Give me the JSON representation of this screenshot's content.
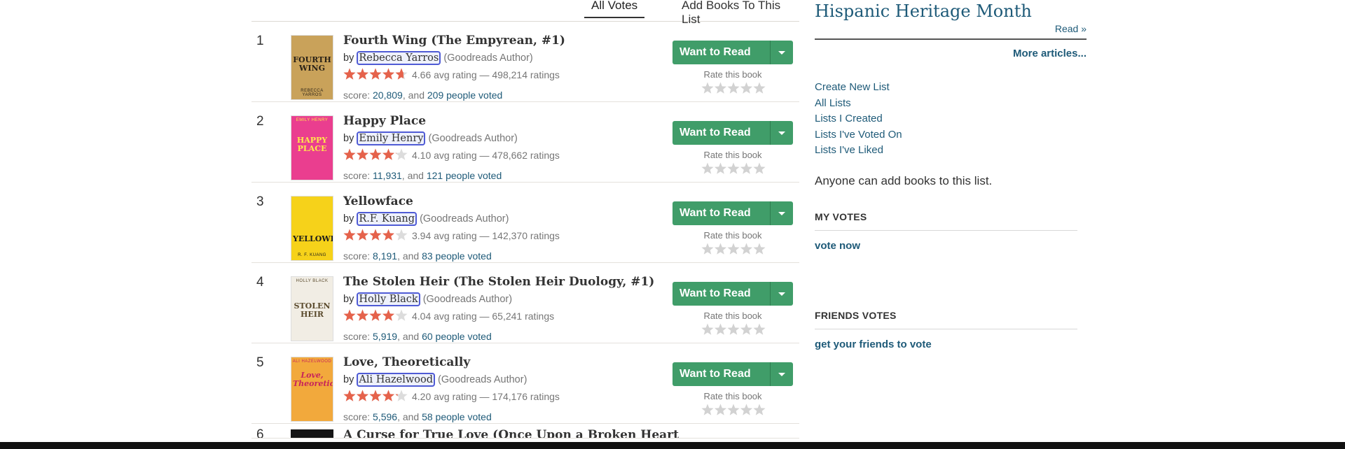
{
  "tabs": {
    "all_votes": "All Votes",
    "add_books": "Add Books To This List"
  },
  "colors": {
    "star_filled": "#e5624b",
    "star_empty": "#dcdcdc",
    "rate_star": "#d2d2d2",
    "wtr_green": "#409d69",
    "link_blue": "#1e5a78",
    "author_outline": "#4f5bd5"
  },
  "books": [
    {
      "rank": "1",
      "title": "Fourth Wing (The Empyrean, #1)",
      "by": "by",
      "author": "Rebecca Yarros",
      "author_note": "(Goodreads Author)",
      "avg_rating": 4.66,
      "rating_text": "4.66 avg rating — 498,214 ratings",
      "score_prefix": "score: ",
      "score_value": "20,809",
      "score_mid": ", and ",
      "voters": "209 people voted",
      "want_to_read": "Want to Read",
      "rate_label": "Rate this book",
      "cover_icon": "book-cover",
      "cover_text": "FOURTH WING",
      "cover_author": "REBECCA YARROS",
      "cover_bg": "#c9a25a",
      "cover_fg": "#2a2217"
    },
    {
      "rank": "2",
      "title": "Happy Place",
      "by": "by",
      "author": "Emily Henry",
      "author_note": "(Goodreads Author)",
      "avg_rating": 4.1,
      "rating_text": "4.10 avg rating — 478,662 ratings",
      "score_prefix": "score: ",
      "score_value": "11,931",
      "score_mid": ", and ",
      "voters": "121 people voted",
      "want_to_read": "Want to Read",
      "rate_label": "Rate this book",
      "cover_icon": "book-cover",
      "cover_text": "HAPPY PLACE",
      "cover_author": "EMILY HENRY",
      "cover_bg": "#ea3e8f",
      "cover_fg": "#ffe94a"
    },
    {
      "rank": "3",
      "title": "Yellowface",
      "by": "by",
      "author": "R.F. Kuang",
      "author_note": "(Goodreads Author)",
      "avg_rating": 3.94,
      "rating_text": "3.94 avg rating — 142,370 ratings",
      "score_prefix": "score: ",
      "score_value": "8,191",
      "score_mid": ", and ",
      "voters": "83 people voted",
      "want_to_read": "Want to Read",
      "rate_label": "Rate this book",
      "cover_icon": "book-cover",
      "cover_text": "YELLOWFACE",
      "cover_author": "R. F. KUANG",
      "cover_bg": "#f6d21a",
      "cover_fg": "#1b1b1b"
    },
    {
      "rank": "4",
      "title": "The Stolen Heir (The Stolen Heir Duology, #1)",
      "by": "by",
      "author": "Holly Black",
      "author_note": "(Goodreads Author)",
      "avg_rating": 4.04,
      "rating_text": "4.04 avg rating — 65,241 ratings",
      "score_prefix": "score: ",
      "score_value": "5,919",
      "score_mid": ", and ",
      "voters": "60 people voted",
      "want_to_read": "Want to Read",
      "rate_label": "Rate this book",
      "cover_icon": "book-cover",
      "cover_text": "STOLEN HEIR",
      "cover_author": "HOLLY BLACK",
      "cover_bg": "#f1ede4",
      "cover_fg": "#5a4a2c"
    },
    {
      "rank": "5",
      "title": "Love, Theoretically",
      "by": "by",
      "author": "Ali Hazelwood",
      "author_note": "(Goodreads Author)",
      "avg_rating": 4.2,
      "rating_text": "4.20 avg rating — 174,176 ratings",
      "score_prefix": "score: ",
      "score_value": "5,596",
      "score_mid": ", and ",
      "voters": "58 people voted",
      "want_to_read": "Want to Read",
      "rate_label": "Rate this book",
      "cover_icon": "book-cover",
      "cover_text": "Love, Theoretically",
      "cover_author": "ALI HAZELWOOD",
      "cover_bg": "#f2a93c",
      "cover_fg": "#c8255a"
    }
  ],
  "peek": {
    "rank": "6",
    "title": "A Curse for True Love (Once Upon a Broken Heart"
  },
  "sidebar": {
    "article_title": "Hispanic Heritage Month",
    "read": "Read »",
    "more_articles": "More articles...",
    "links": [
      "Create New List",
      "All Lists",
      "Lists I Created",
      "Lists I've Voted On",
      "Lists I've Liked"
    ],
    "anyone_text": "Anyone can add books to this list.",
    "my_votes_heading": "MY VOTES",
    "vote_now": "vote now",
    "friends_votes_heading": "FRIENDS VOTES",
    "friends_link": "get your friends to vote"
  }
}
